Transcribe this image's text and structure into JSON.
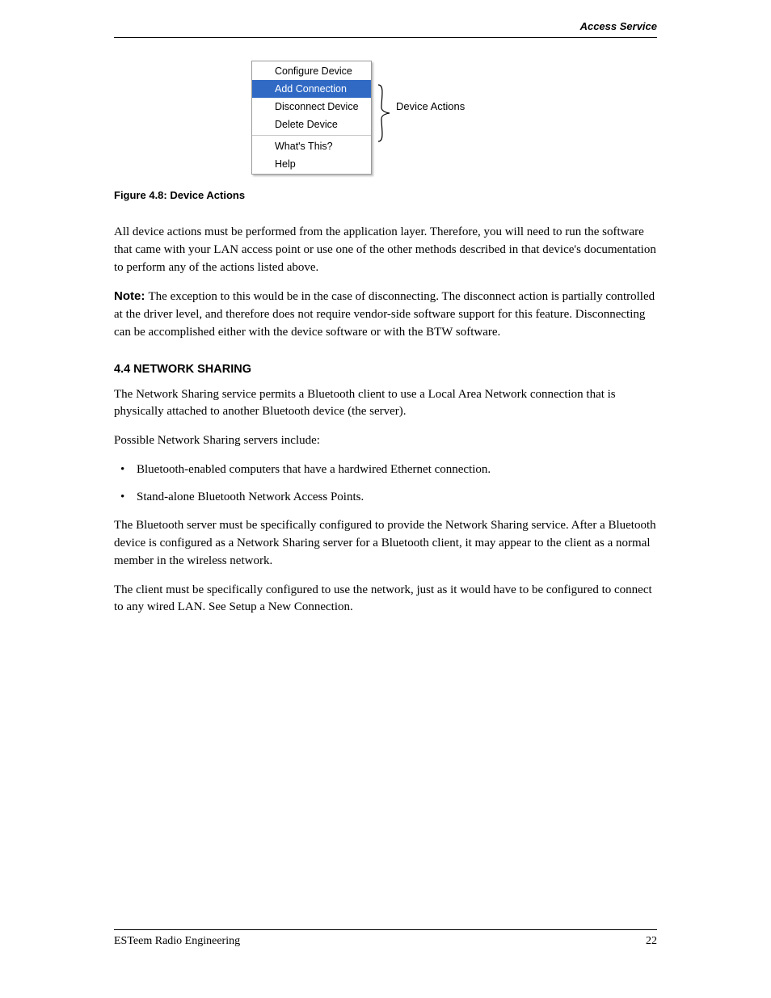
{
  "header": {
    "right": "Access Service"
  },
  "menu": {
    "items": [
      {
        "label": "Configure Device",
        "selected": false
      },
      {
        "label": "Add Connection",
        "selected": true
      },
      {
        "label": "Disconnect Device",
        "selected": false
      },
      {
        "label": "Delete Device",
        "selected": false
      }
    ],
    "help_items": [
      {
        "label": "What's This?"
      },
      {
        "label": "Help"
      }
    ],
    "brace_label": "Device Actions"
  },
  "caption": "Figure 4.8: Device Actions",
  "body": {
    "p1": "All device actions must be performed from the application layer. Therefore, you will need to run the software that came with your LAN access point or use one of the other methods described in that device's documentation to perform any of the actions listed above.",
    "note_p": "The exception to this would be in the case of disconnecting. The disconnect action is partially controlled at the driver level, and therefore does not require vendor-side software support for this feature. Disconnecting can be accomplished either with the device software or with the BTW software."
  },
  "section": {
    "heading": "4.4 NETWORK SHARING",
    "p1": "The Network Sharing service permits a Bluetooth client to use a Local Area Network connection that is physically attached to another Bluetooth device (the server).",
    "bullets_intro": "Possible Network Sharing servers include:",
    "bullets": [
      "Bluetooth-enabled computers that have a hardwired Ethernet connection.",
      "Stand-alone Bluetooth Network Access Points."
    ],
    "p2": "The Bluetooth server must be specifically configured to provide the Network Sharing service. After a Bluetooth device is configured as a Network Sharing server for a Bluetooth client, it may appear to the client as a normal member in the wireless network.",
    "p3_prefix": "The client must be specifically configured to use the network, just as it would have to be configured to connect to any wired LAN. See ",
    "p3_link": "Setup a New Connection",
    "p3_suffix": "."
  },
  "footer": {
    "left": "ESTeem Radio Engineering",
    "right": "22"
  }
}
